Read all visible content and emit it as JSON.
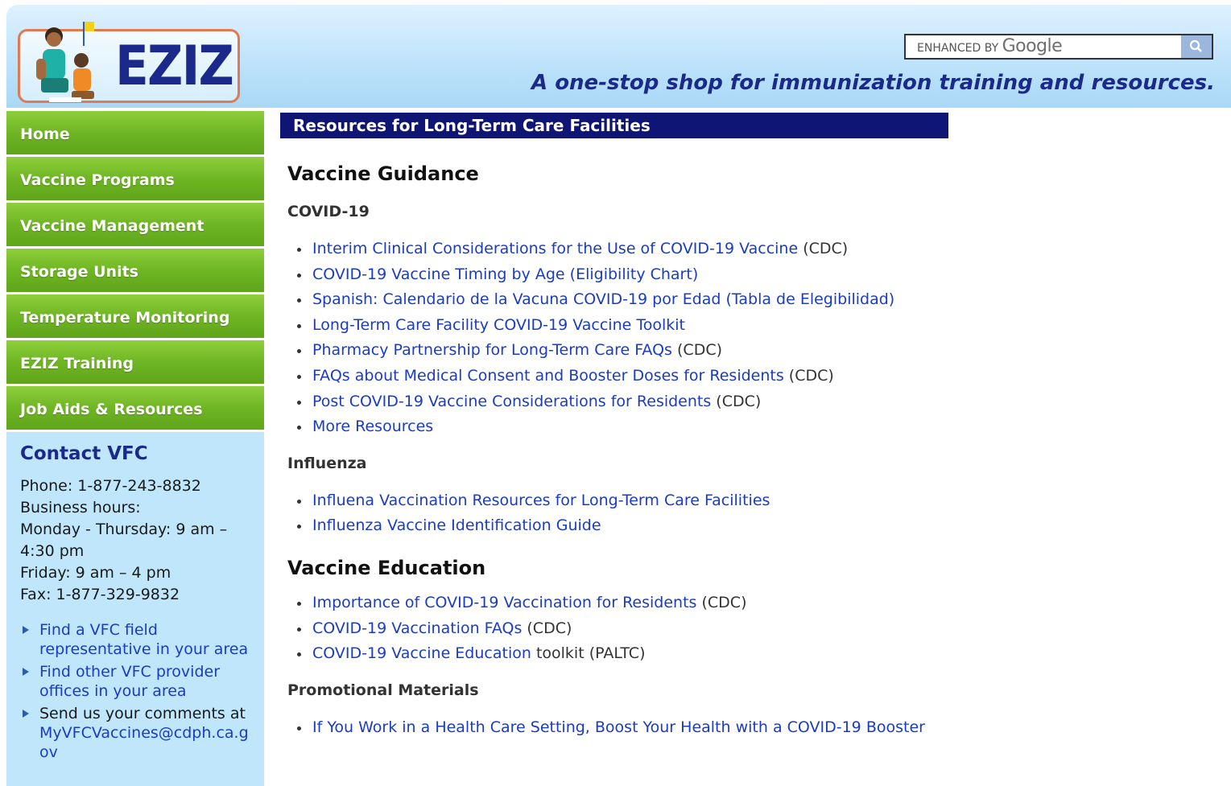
{
  "header": {
    "logo_text": "EZIZ",
    "search_prefix": "ENHANCED BY",
    "search_brand": "Google",
    "tagline": "A one-stop shop for immunization training and resources."
  },
  "nav": [
    {
      "label": "Home"
    },
    {
      "label": "Vaccine Programs"
    },
    {
      "label": "Vaccine Management"
    },
    {
      "label": "Storage Units"
    },
    {
      "label": "Temperature Monitoring"
    },
    {
      "label": "EZIZ Training"
    },
    {
      "label": "Job Aids & Resources"
    }
  ],
  "contact": {
    "heading": "Contact VFC",
    "phone": "Phone: 1-877-243-8832",
    "hours_label": "Business hours:",
    "hours_weekday": "Monday - Thursday: 9 am –",
    "hours_weekday_end": "4:30 pm",
    "hours_friday": "Friday: 9 am – 4 pm",
    "fax": "Fax: 1-877-329-9832",
    "links": {
      "field_rep": "Find a VFC field representative in your area",
      "other_offices": "Find other VFC provider offices in your area",
      "comments_prefix": "Send us your comments at",
      "email": "MyVFCVaccines@cdph.ca.gov"
    }
  },
  "main": {
    "title": "Resources for Long-Term Care Facilities",
    "vaccine_guidance": {
      "heading": "Vaccine Guidance",
      "covid": {
        "heading": "COVID-19",
        "items": [
          {
            "link": "Interim Clinical Considerations for the Use of COVID-19 Vaccine",
            "suffix": " (CDC)"
          },
          {
            "link": "COVID-19 Vaccine Timing by Age (Eligibility Chart)",
            "suffix": ""
          },
          {
            "link": "Spanish: Calendario de la Vacuna COVID-19 por Edad (Tabla de Elegibilidad)",
            "suffix": ""
          },
          {
            "link": "Long-Term Care Facility COVID-19 Vaccine Toolkit",
            "suffix": ""
          },
          {
            "link": "Pharmacy Partnership for Long-Term Care FAQs",
            "suffix": " (CDC)"
          },
          {
            "link": "FAQs about Medical Consent and Booster Doses for Residents",
            "suffix": " (CDC)"
          },
          {
            "link": "Post COVID-19 Vaccine Considerations for Residents",
            "suffix": " (CDC)"
          },
          {
            "link": "More Resources",
            "suffix": ""
          }
        ]
      },
      "influenza": {
        "heading": "Influenza",
        "items": [
          {
            "link": "Influena Vaccination Resources for Long-Term Care Facilities",
            "suffix": ""
          },
          {
            "link": "Influenza Vaccine Identification Guide",
            "suffix": ""
          }
        ]
      }
    },
    "vaccine_education": {
      "heading": "Vaccine Education",
      "items": [
        {
          "link": "Importance of COVID-19 Vaccination for Residents",
          "suffix": " (CDC)"
        },
        {
          "link": "COVID-19 Vaccination FAQs",
          "suffix": " (CDC)"
        },
        {
          "link": "COVID-19 Vaccine Education",
          "suffix": " toolkit (PALTC)"
        }
      ]
    },
    "promotional": {
      "heading": "Promotional Materials",
      "items": [
        {
          "link": "If You Work in a Health Care Setting, Boost Your Health with a COVID-19 Booster",
          "suffix": ""
        }
      ]
    }
  },
  "colors": {
    "header_bg": "#bfe3fb",
    "nav_green": "#6fb624",
    "title_bar": "#0f1575",
    "link": "#1a3cc4",
    "contact_bg": "#bfe6fa"
  },
  "icons": {
    "search": "magnifier-icon",
    "bullet": "triangle-right-icon"
  }
}
